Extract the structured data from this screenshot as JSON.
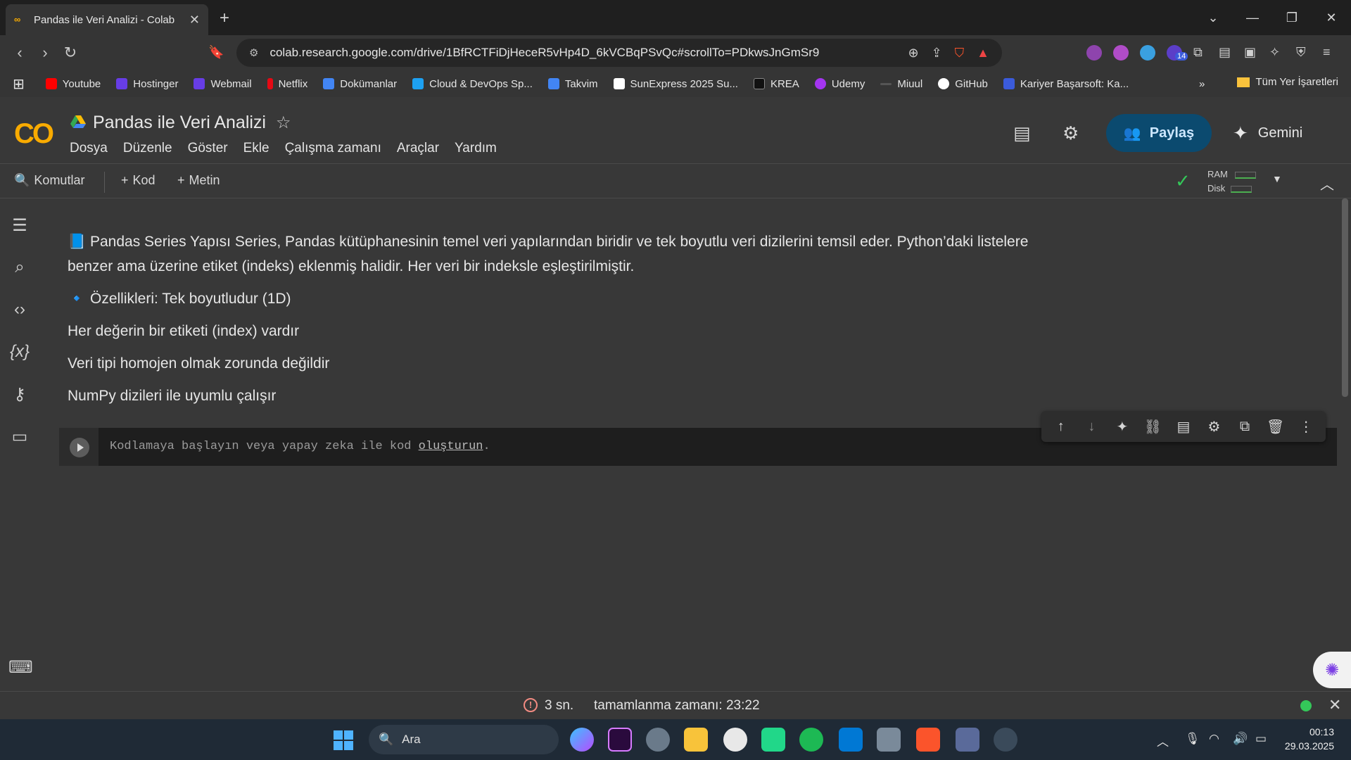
{
  "browser": {
    "tab_title": "Pandas ile Veri Analizi - Colab",
    "url": "colab.research.google.com/drive/1BfRCTFiDjHeceR5vHp4D_6kVCBqPSvQc#scrollTo=PDkwsJnGmSr9",
    "extension_badge": "14",
    "bookmarks": [
      {
        "label": "Youtube",
        "color": "#ff0000"
      },
      {
        "label": "Hostinger",
        "color": "#673de6"
      },
      {
        "label": "Webmail",
        "color": "#673de6"
      },
      {
        "label": "Netflix",
        "color": "#e50914"
      },
      {
        "label": "Dokümanlar",
        "color": "#4285f4"
      },
      {
        "label": "Cloud & DevOps Sp...",
        "color": "#1da1f2"
      },
      {
        "label": "Takvim",
        "color": "#4285f4"
      },
      {
        "label": "SunExpress 2025 Su...",
        "color": "#ffffff"
      },
      {
        "label": "KREA",
        "color": "#111111"
      },
      {
        "label": "Udemy",
        "color": "#a435f0"
      },
      {
        "label": "Miuul",
        "color": "#444444"
      },
      {
        "label": "GitHub",
        "color": "#ffffff"
      },
      {
        "label": "Kariyer Başarsoft: Ka...",
        "color": "#3b5bdb"
      }
    ],
    "all_bookmarks": "Tüm Yer İşaretleri"
  },
  "colab": {
    "notebook_title": "Pandas ile Veri Analizi",
    "menus": [
      "Dosya",
      "Düzenle",
      "Göster",
      "Ekle",
      "Çalışma zamanı",
      "Araçlar",
      "Yardım"
    ],
    "share_label": "Paylaş",
    "gemini_label": "Gemini",
    "toolbar": {
      "commands": "Komutlar",
      "add_code": "Kod",
      "add_text": "Metin",
      "ram": "RAM",
      "disk": "Disk"
    }
  },
  "text_cell": {
    "para1": "📘 Pandas Series Yapısı Series, Pandas kütüphanesinin temel veri yapılarından biridir ve tek boyutlu veri dizilerini temsil eder. Python’daki listelere benzer ama üzerine etiket (indeks) eklenmiş halidir. Her veri bir indeksle eşleştirilmiştir.",
    "para2": "🔹 Özellikleri: Tek boyutludur (1D)",
    "para3": "Her değerin bir etiketi (index) vardır",
    "para4": "Veri tipi homojen olmak zorunda değildir",
    "para5": "NumPy dizileri ile uyumlu çalışır"
  },
  "code_cell": {
    "placeholder_prefix": "Kodlamaya başlayın veya yapay zeka ile kod ",
    "placeholder_link": "oluşturun",
    "placeholder_suffix": "."
  },
  "status": {
    "duration": "3 sn.",
    "completed": "tamamlanma zamanı: 23:22"
  },
  "taskbar": {
    "search_label": "Ara",
    "time": "00:13",
    "date": "29.03.2025"
  },
  "colors": {
    "accent_share": "#0b4a6f",
    "colab_orange": "#f9ab00",
    "status_ok": "#34c759"
  }
}
